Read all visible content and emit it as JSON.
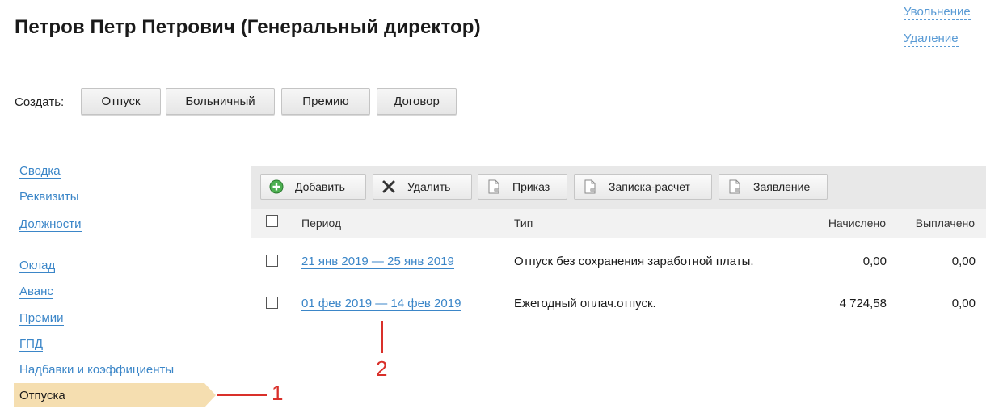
{
  "header": {
    "title": "Петров Петр Петрович (Генеральный директор)",
    "links": [
      "Увольнение",
      "Удаление"
    ]
  },
  "create": {
    "label": "Создать:",
    "buttons": [
      "Отпуск",
      "Больничный",
      "Премию",
      "Договор"
    ]
  },
  "sidebar": {
    "items": [
      "Сводка",
      "Реквизиты",
      "Должности",
      "Оклад",
      "Аванс",
      "Премии",
      "ГПД",
      "Надбавки и коэффициенты"
    ],
    "active": "Отпуска"
  },
  "toolbar": {
    "add": "Добавить",
    "delete": "Удалить",
    "order": "Приказ",
    "calc_note": "Записка-расчет",
    "application": "Заявление"
  },
  "table": {
    "columns": [
      "Период",
      "Тип",
      "Начислено",
      "Выплачено"
    ],
    "rows": [
      {
        "period": "21 янв 2019 — 25 янв 2019",
        "type": "Отпуск без сохранения заработной платы.",
        "accrued": "0,00",
        "paid": "0,00"
      },
      {
        "period": "01 фев 2019 — 14 фев 2019",
        "type": "Ежегодный оплач.отпуск.",
        "accrued": "4 724,58",
        "paid": "0,00"
      }
    ]
  },
  "annotations": [
    "1",
    "2"
  ],
  "colors": {
    "link": "#3b86c8",
    "active_bg": "#f5deb0",
    "annotation": "#d9302a",
    "toolbar_bg": "#e8e8e8"
  }
}
